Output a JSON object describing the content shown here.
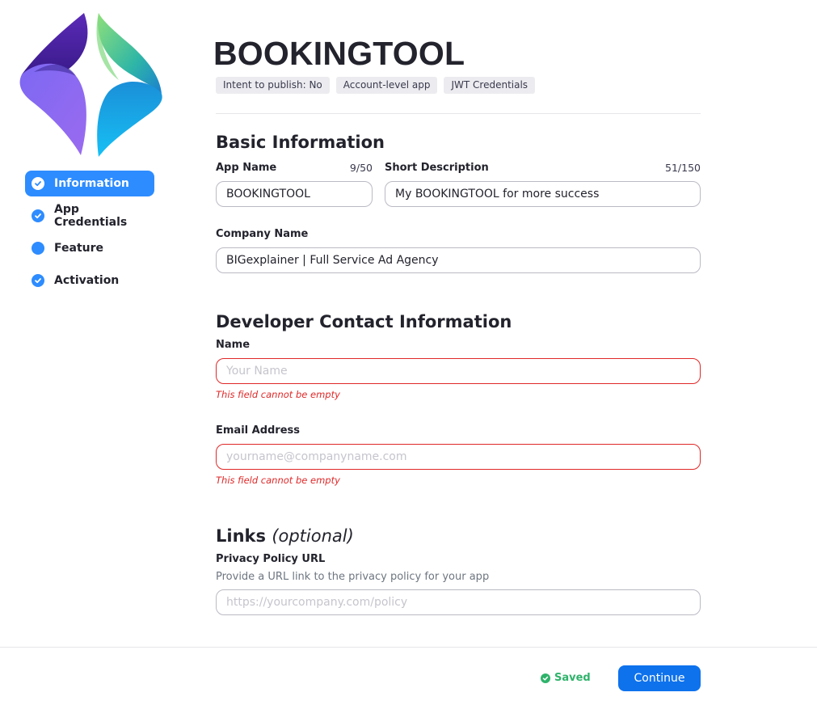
{
  "app": {
    "title": "BOOKINGTOOL",
    "tags": [
      "Intent to publish: No",
      "Account-level app",
      "JWT Credentials"
    ]
  },
  "nav": {
    "items": [
      {
        "label": "Information",
        "icon": "check-circle-icon",
        "active": true
      },
      {
        "label": "App Credentials",
        "icon": "check-circle-icon",
        "active": false
      },
      {
        "label": "Feature",
        "icon": "dot-icon",
        "active": false
      },
      {
        "label": "Activation",
        "icon": "check-circle-icon",
        "active": false
      }
    ]
  },
  "basic_info": {
    "title": "Basic Information",
    "app_name_label": "App Name",
    "app_name_counter": "9/50",
    "app_name_value": "BOOKINGTOOL",
    "short_desc_label": "Short Description",
    "short_desc_counter": "51/150",
    "short_desc_value": "My BOOKINGTOOL for more success",
    "company_label": "Company Name",
    "company_value": "BIGexplainer | Full Service Ad Agency"
  },
  "developer_contact": {
    "title": "Developer Contact Information",
    "name_label": "Name",
    "name_placeholder": "Your Name",
    "name_error": "This field cannot be empty",
    "email_label": "Email Address",
    "email_placeholder": "yourname@companyname.com",
    "email_error": "This field cannot be empty"
  },
  "links": {
    "title": "Links",
    "title_suffix": "(optional)",
    "privacy_label": "Privacy Policy URL",
    "privacy_hint": "Provide a URL link to the privacy policy for your app",
    "privacy_placeholder": "https://yourcompany.com/policy"
  },
  "footer": {
    "saved_label": "Saved",
    "continue_label": "Continue"
  },
  "colors": {
    "accent": "#2d8cff",
    "button": "#0e72ed",
    "error": "#e02828",
    "success": "#2fb36b"
  }
}
